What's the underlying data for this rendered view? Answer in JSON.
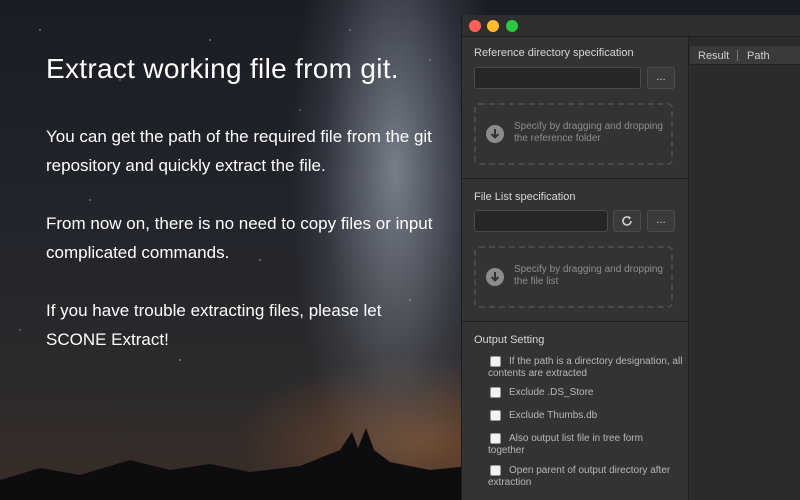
{
  "hero": {
    "heading": "Extract working file from git.",
    "paragraphs": [
      "You can get the path of the required file from the git repository and quickly extract the file.",
      "From now on, there is no need to copy files or input complicated commands.",
      "If you have trouble extracting files, please let SCONE Extract!"
    ]
  },
  "window": {
    "traffic_lights": {
      "close": "#fe5f57",
      "minimize": "#febc2e",
      "zoom": "#29c840"
    }
  },
  "reference": {
    "title": "Reference directory specification",
    "input_value": "",
    "browse_label": "...",
    "drop_text": "Specify by dragging and dropping the reference folder",
    "drop_icon": "arrow-down-circle-icon"
  },
  "file_list": {
    "title": "File List specification",
    "input_value": "",
    "refresh_icon": "refresh-icon",
    "browse_label": "...",
    "drop_text": "Specify by dragging and dropping the file list",
    "drop_icon": "arrow-down-circle-icon"
  },
  "output": {
    "title": "Output Setting",
    "options": [
      {
        "label": "If the path is a directory designation, all contents are extracted",
        "checked": false
      },
      {
        "label": "Exclude .DS_Store",
        "checked": false
      },
      {
        "label": "Exclude Thumbs.db",
        "checked": false
      },
      {
        "label": "Also output list file in tree form together",
        "checked": false
      },
      {
        "label": "Open parent of output directory after extraction",
        "checked": false
      }
    ]
  },
  "result": {
    "columns": [
      "Result",
      "Path"
    ]
  }
}
